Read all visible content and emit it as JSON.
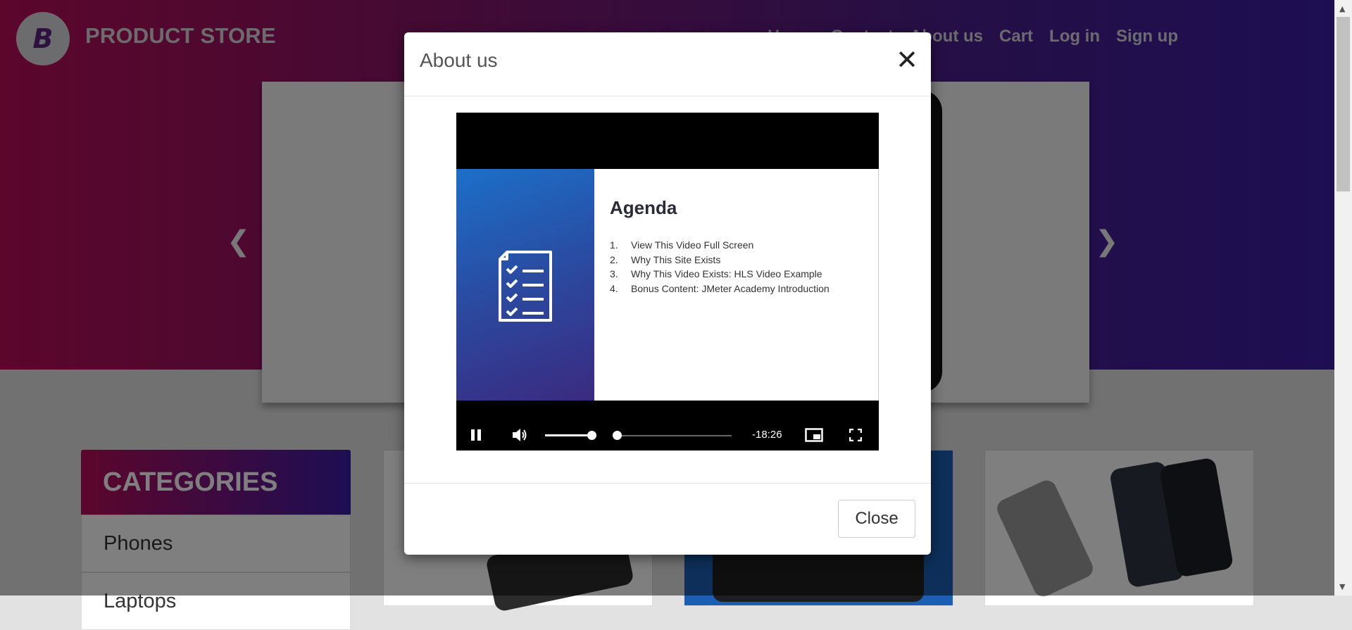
{
  "navbar": {
    "brand": "PRODUCT STORE",
    "links": [
      "Home",
      "Contact",
      "About us",
      "Cart",
      "Log in",
      "Sign up"
    ]
  },
  "categories": {
    "header": "CATEGORIES",
    "items": [
      "Phones",
      "Laptops"
    ]
  },
  "modal": {
    "title": "About us",
    "close_label": "Close",
    "video": {
      "slide_title": "Agenda",
      "agenda": [
        {
          "num": "1.",
          "text": "View This Video Full Screen"
        },
        {
          "num": "2.",
          "text": "Why This Site Exists"
        },
        {
          "num": "3.",
          "text": "Why This Video Exists: HLS Video Example"
        },
        {
          "num": "4.",
          "text": "Bonus Content: JMeter Academy Introduction"
        }
      ],
      "time_remaining": "-18:26",
      "volume_level": 0.85,
      "progress": 0.0
    }
  },
  "colors": {
    "hero_start": "#b80d57",
    "hero_end": "#3a1ca6",
    "overlay": "rgba(0,0,0,0.5)"
  },
  "icons": {
    "logo": "B",
    "prev": "chevron-left-icon",
    "next": "chevron-right-icon",
    "close": "close-icon"
  }
}
